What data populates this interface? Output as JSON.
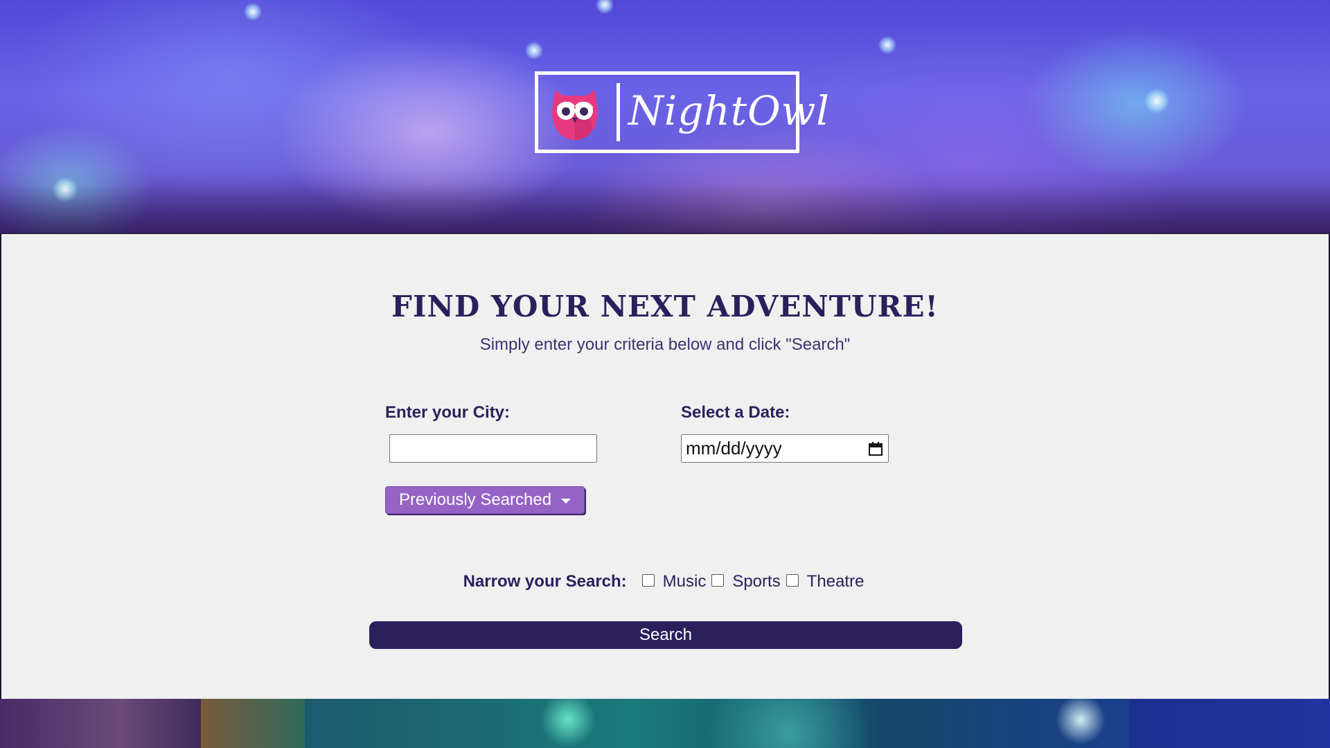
{
  "brand": {
    "name": "NightOwl"
  },
  "main": {
    "title": "FIND YOUR NEXT ADVENTURE!",
    "subtitle": "Simply enter your criteria below and click \"Search\"",
    "city": {
      "label": "Enter your City:",
      "value": "",
      "placeholder": ""
    },
    "date": {
      "label": "Select a Date:",
      "placeholder": "mm/dd/yyyy"
    },
    "previous_searched_label": "Previously Searched",
    "narrow": {
      "label": "Narrow your Search:",
      "options": [
        {
          "label": "Music",
          "checked": false
        },
        {
          "label": "Sports",
          "checked": false
        },
        {
          "label": "Theatre",
          "checked": false
        }
      ]
    },
    "search_label": "Search"
  },
  "colors": {
    "primary": "#2b1f5c",
    "accent_purple": "#9563c6",
    "logo_pink": "#e8397e",
    "content_bg": "#f0f0f0"
  },
  "icons": {
    "logo": "owl-logo-icon",
    "calendar": "calendar-icon",
    "dropdown": "caret-down-icon"
  }
}
